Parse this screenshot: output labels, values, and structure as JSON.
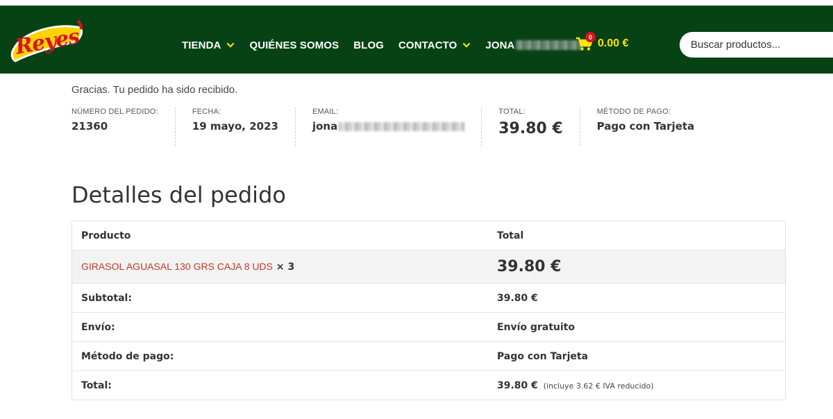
{
  "brand": {
    "logo_text": "Reyes"
  },
  "nav": {
    "items": [
      {
        "label": "TIENDA",
        "has_dropdown": true
      },
      {
        "label": "QUIÉNES SOMOS",
        "has_dropdown": false
      },
      {
        "label": "BLOG",
        "has_dropdown": false
      },
      {
        "label": "CONTACTO",
        "has_dropdown": true
      }
    ],
    "user_label": "JONA"
  },
  "cart": {
    "count": "0",
    "total": "0.00 €"
  },
  "search": {
    "placeholder": "Buscar productos..."
  },
  "order": {
    "thanks": "Gracias. Tu pedido ha sido recibido.",
    "number_label": "NÚMERO DEL PEDIDO:",
    "number": "21360",
    "date_label": "FECHA:",
    "date": "19 mayo, 2023",
    "email_label": "EMAIL:",
    "email": "jona",
    "total_label": "TOTAL:",
    "total": "39.80 €",
    "payment_label": "MÉTODO DE PAGO:",
    "payment": "Pago con Tarjeta"
  },
  "details": {
    "title": "Detalles del pedido",
    "col_product": "Producto",
    "col_total": "Total",
    "product_name": "GIRASOL AGUASAL 130 GRS CAJA 8 UDS",
    "product_qty": "× 3",
    "product_total": "39.80 €",
    "subtotal_label": "Subtotal:",
    "subtotal": "39.80 €",
    "shipping_label": "Envío:",
    "shipping": "Envío gratuito",
    "payment_label": "Método de pago:",
    "payment": "Pago con Tarjeta",
    "total_label": "Total:",
    "total": "39.80 €",
    "tax_note": "(incluye 3.62 € IVA reducido)"
  },
  "colors": {
    "header_bg": "#064214",
    "accent_yellow": "#ffe600",
    "brand_red": "#d8141a",
    "link_red": "#c0392b"
  }
}
